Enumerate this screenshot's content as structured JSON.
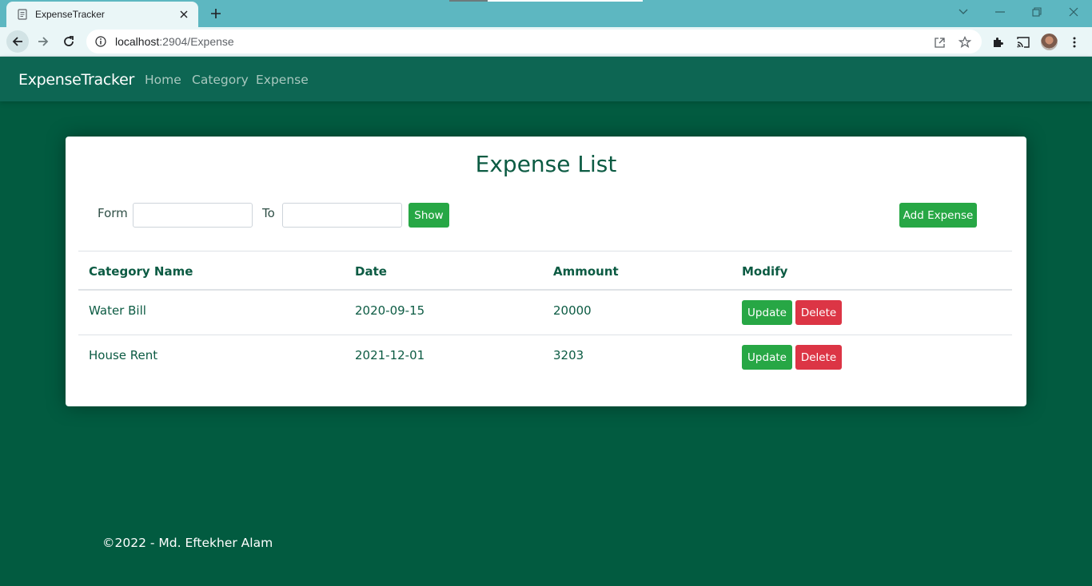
{
  "browser": {
    "tab_title": "ExpenseTracker",
    "url_host": "localhost",
    "url_path": ":2904/Expense"
  },
  "navbar": {
    "brand": "ExpenseTracker",
    "links": [
      {
        "label": "Home"
      },
      {
        "label": "Category"
      },
      {
        "label": "Expense"
      }
    ]
  },
  "expense_list": {
    "title": "Expense List",
    "filter": {
      "from_label": "Form",
      "from_value": "",
      "to_label": "To",
      "to_value": "",
      "show_label": "Show"
    },
    "add_label": "Add Expense",
    "columns": [
      "Category Name",
      "Date",
      "Ammount",
      "Modify"
    ],
    "rows": [
      {
        "category": "Water Bill",
        "date": "2020-09-15",
        "amount": "20000",
        "update": "Update",
        "delete": "Delete"
      },
      {
        "category": "House Rent",
        "date": "2021-12-01",
        "amount": "3203",
        "update": "Update",
        "delete": "Delete"
      }
    ]
  },
  "footer": {
    "text": "©2022 - Md. Eftekher Alam"
  },
  "colors": {
    "page_bg": "#025b40",
    "navbar_bg": "#0d6653",
    "accent_green": "#27a745",
    "danger_red": "#dc3545",
    "heading_green": "#0c5b43"
  }
}
